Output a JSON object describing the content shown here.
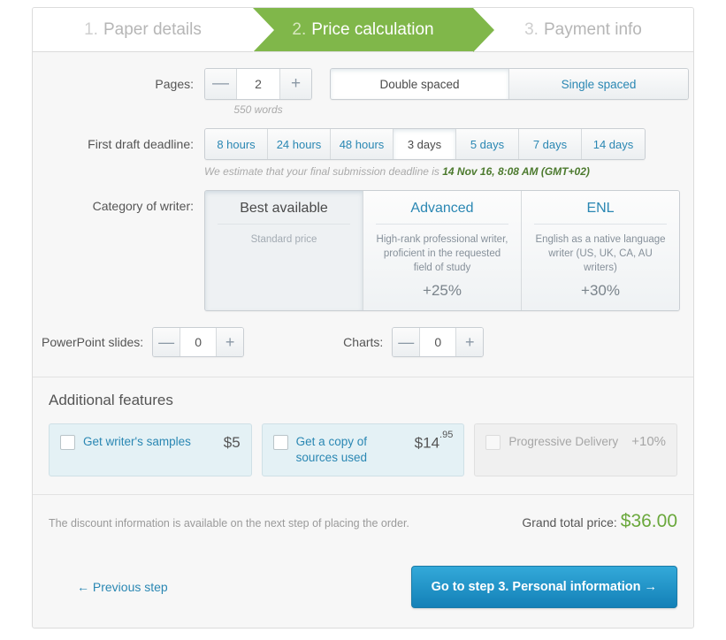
{
  "steps": [
    {
      "num": "1.",
      "label": "Paper details",
      "active": false
    },
    {
      "num": "2.",
      "label": "Price calculation",
      "active": true
    },
    {
      "num": "3.",
      "label": "Payment info",
      "active": false
    }
  ],
  "pages": {
    "label": "Pages:",
    "minus": "—",
    "plus": "+",
    "value": "2",
    "words_note": "550 words",
    "spacing_options": [
      "Double spaced",
      "Single spaced"
    ],
    "spacing_selected": "Double spaced"
  },
  "deadline": {
    "label": "First draft deadline:",
    "options": [
      "8 hours",
      "24 hours",
      "48 hours",
      "3 days",
      "5 days",
      "7 days",
      "14 days"
    ],
    "selected": "3 days",
    "estimate_prefix": "We estimate that your final submission deadline is ",
    "estimate_date": "14 Nov 16, 8:08 AM (GMT+02)"
  },
  "writer": {
    "label": "Category of writer:",
    "cards": [
      {
        "title": "Best available",
        "desc": "Standard price",
        "pct": "",
        "selected": true
      },
      {
        "title": "Advanced",
        "desc": "High-rank professional writer, proficient in the requested field of study",
        "pct": "+25%",
        "selected": false
      },
      {
        "title": "ENL",
        "desc": "English as a native language writer (US, UK, CA, AU writers)",
        "pct": "+30%",
        "selected": false
      }
    ]
  },
  "counters": {
    "slides_label": "PowerPoint slides:",
    "slides_value": "0",
    "charts_label": "Charts:",
    "charts_value": "0",
    "minus": "—",
    "plus": "+"
  },
  "features": {
    "title": "Additional features",
    "items": [
      {
        "name": "Get writer's samples",
        "price": "$5",
        "price_sup": "",
        "disabled": false
      },
      {
        "name": "Get a copy of sources used",
        "price": "$14",
        "price_sup": ".95",
        "disabled": false
      },
      {
        "name": "Progressive Delivery",
        "price": "+10%",
        "price_sup": "",
        "disabled": true
      }
    ]
  },
  "footer": {
    "discount_note": "The discount information is available on the next step of placing the order.",
    "grand_label": "Grand total price:",
    "grand_amount": "$36.00",
    "prev_label": "← Previous step",
    "cta_label": "Go to step 3. Personal information →"
  },
  "colors": {
    "accent_green": "#80b74a",
    "accent_blue": "#2a87b3",
    "price_green": "#6aa83c",
    "cta_blue_top": "#33a9d9",
    "cta_blue_bottom": "#1380b7"
  }
}
